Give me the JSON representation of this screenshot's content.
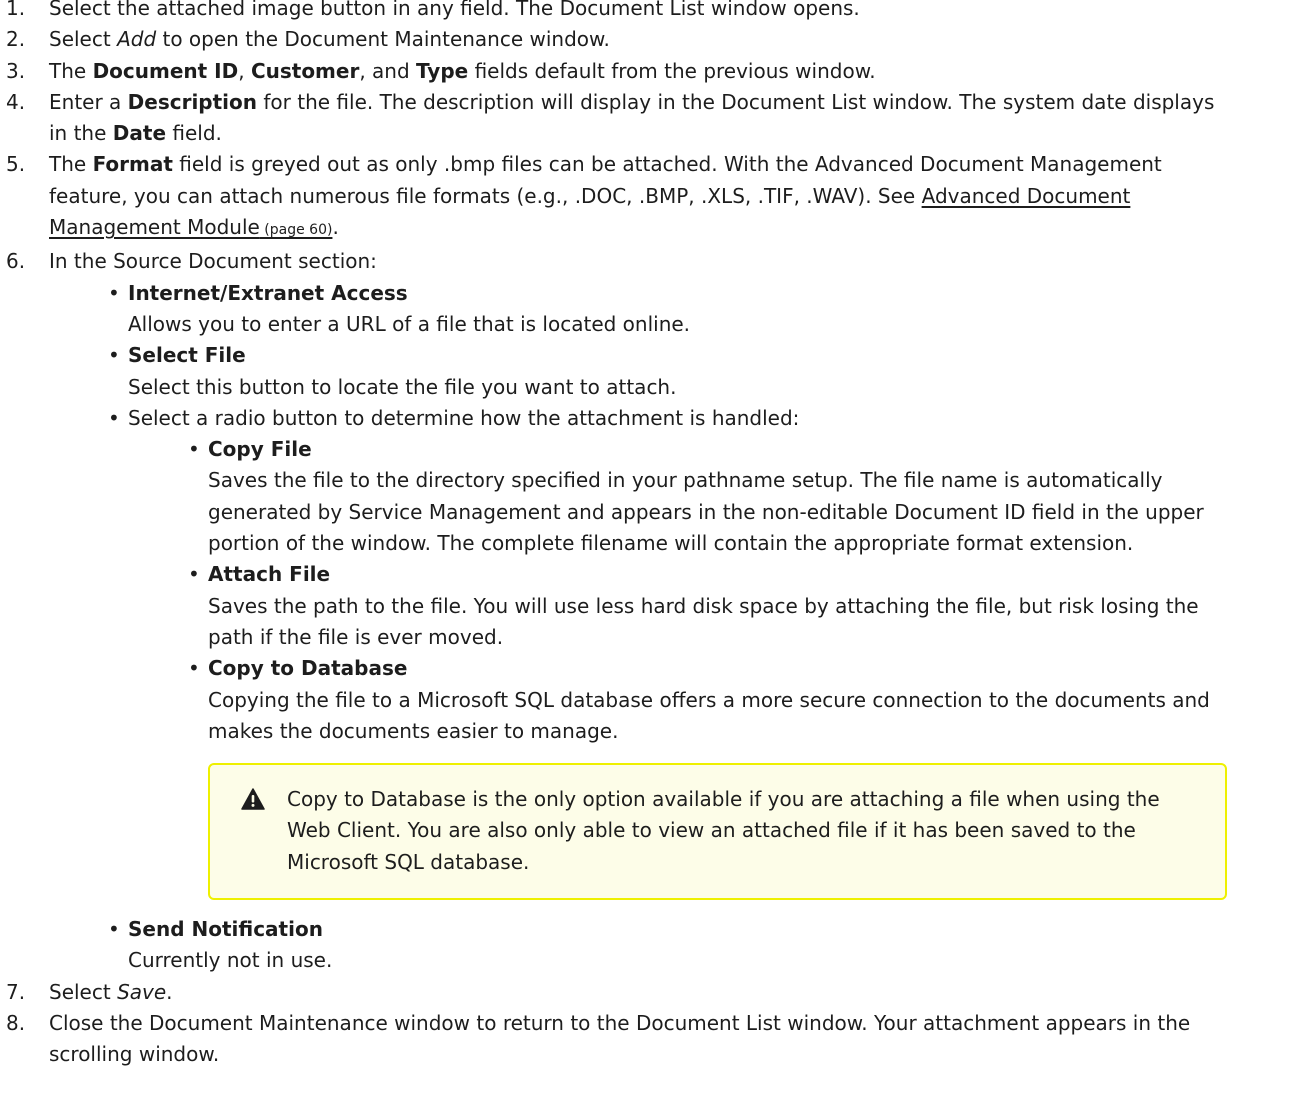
{
  "steps": [
    {
      "num": "1.",
      "t1": "Select the attached image button in any field. The Document List window opens."
    },
    {
      "num": "2.",
      "t1": "Select ",
      "i1": "Add",
      "t2": " to open the Document Maintenance window."
    },
    {
      "num": "3.",
      "t1": "The ",
      "b1": "Document ID",
      "t2": ", ",
      "b2": "Customer",
      "t3": ", and ",
      "b3": "Type",
      "t4": " fields default from the previous window."
    },
    {
      "num": "4.",
      "t1": "Enter a ",
      "b1": "Description",
      "t2": " for the file. The description will display in the Document List window. The system date displays in the ",
      "b2": "Date",
      "t3": " field."
    },
    {
      "num": "5.",
      "t1": "The ",
      "b1": "Format",
      "t2": " field is greyed out as only .bmp files can be attached. With the Advanced Document Management feature, you can attach numerous file formats (e.g., .DOC, .BMP, .XLS, .TIF, .WAV). See ",
      "link": "Advanced Document Management Module",
      "pageref": " (page 60)",
      "t3": "."
    },
    {
      "num": "6.",
      "t1": "In the Source Document section:"
    },
    {
      "num": "7.",
      "t1": "Select ",
      "i1": "Save",
      "t2": "."
    },
    {
      "num": "8.",
      "t1": "Close the Document Maintenance window to return to the Document List window. Your attachment appears in the scrolling window."
    }
  ],
  "source_items": {
    "internet": {
      "title": "Internet/Extranet Access",
      "desc": "Allows you to enter a URL of a file that is located online."
    },
    "select_file": {
      "title": "Select File",
      "desc": "Select this button to locate the file you want to attach."
    },
    "radio_intro": "Select a radio button to determine how the attachment is handled:",
    "copy_file": {
      "title": "Copy File",
      "desc": "Saves the file to the directory specified in your pathname setup. The file name is automatically generated by Service Management and appears in the non-editable Document ID field in the upper portion of the window. The complete filename will contain the appropriate format extension."
    },
    "attach_file": {
      "title": "Attach File",
      "desc": "Saves the path to the file. You will use less hard disk space by attaching the file, but risk losing the path if the file is ever moved."
    },
    "copy_db": {
      "title": "Copy to Database",
      "desc": "Copying the file to a Microsoft SQL database offers a more secure connection to the documents and makes the documents easier to manage."
    },
    "note": "Copy to Database is the only option available if you are attaching a file when using the Web Client. You are also only able to view an attached file if it has been saved to the Microsoft SQL database.",
    "send_notification": {
      "title": "Send Notification",
      "desc": "Currently not in use."
    }
  },
  "bullet_char": "•",
  "icons": {
    "note": "warning-icon"
  },
  "colors": {
    "note_bg": "#fdfde8",
    "note_border": "#eef000",
    "text": "#1d1d1d"
  }
}
